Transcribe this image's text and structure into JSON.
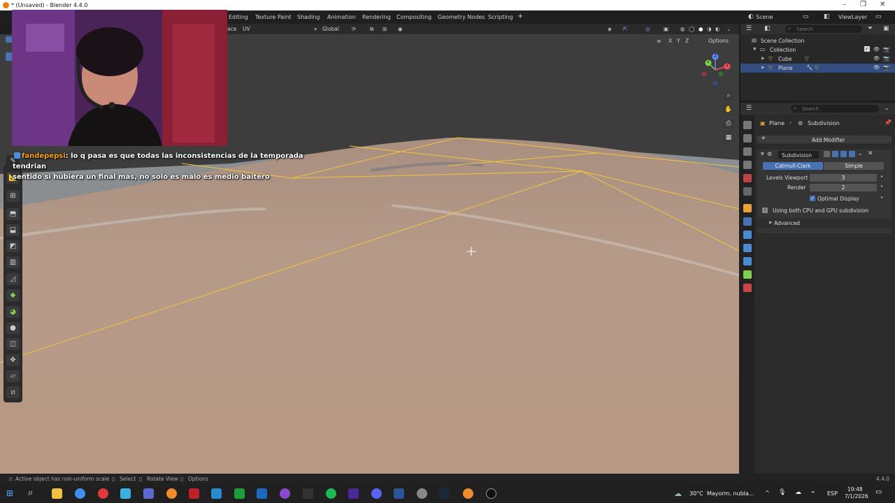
{
  "window": {
    "title": "* (Unsaved) - Blender 4.4.0",
    "controls": [
      "–",
      "❐",
      "✕"
    ]
  },
  "workspace_tabs": [
    "Editing",
    "Texture Paint",
    "Shading",
    "Animation",
    "Rendering",
    "Compositing",
    "Geometry Nodes",
    "Scripting",
    "+"
  ],
  "scene": {
    "label": "Scene",
    "view_layer": "ViewLayer"
  },
  "viewport_header": {
    "mode_fragment": "ace",
    "uv_menu": "UV",
    "orientation": "Global",
    "options_label": "Options",
    "axes": [
      "X",
      "Y",
      "Z"
    ]
  },
  "gizmo": {
    "x": "X",
    "y": "Y",
    "z": "Z"
  },
  "chat": {
    "user": "fandepepsi",
    "message_line1": "lo q pasa es que todas las inconsistencias de la temporada tendrian",
    "message_line2": "sentido si hubiera un final mas, no solo es malo es medio baitero"
  },
  "outliner": {
    "search_placeholder": "Search",
    "root": "Scene Collection",
    "items": [
      {
        "label": "Collection",
        "checked": true
      },
      {
        "label": "Cube"
      },
      {
        "label": "Plane",
        "selected": true
      }
    ]
  },
  "properties": {
    "search_placeholder": "Search",
    "breadcrumb_object": "Plane",
    "breadcrumb_modifier": "Subdivision",
    "add_modifier": "Add Modifier",
    "modifier_name": "Subdivision",
    "type_catmull": "Catmull-Clark",
    "type_simple": "Simple",
    "levels_viewport_label": "Levels Viewport",
    "levels_viewport_value": "3",
    "render_label": "Render",
    "render_value": "2",
    "optimal_display": "Optimal Display",
    "info": "Using both CPU and GPU subdivision",
    "advanced": "Advanced"
  },
  "statusbar": {
    "warning": "Active object has non-uniform scale",
    "select": "Select",
    "rotate": "Rotate View",
    "options": "Options",
    "version": "4.4.0"
  },
  "taskbar": {
    "weather_temp": "30°C",
    "weather_desc": "Mayorm. nubla...",
    "lang": "ESP",
    "time": "19:48",
    "date": "7/1/2026"
  },
  "colors": {
    "accent_blue": "#4772b3",
    "selected_row": "#334d80",
    "mesh_wire": "#f2c53d",
    "surface": "#b69784"
  }
}
